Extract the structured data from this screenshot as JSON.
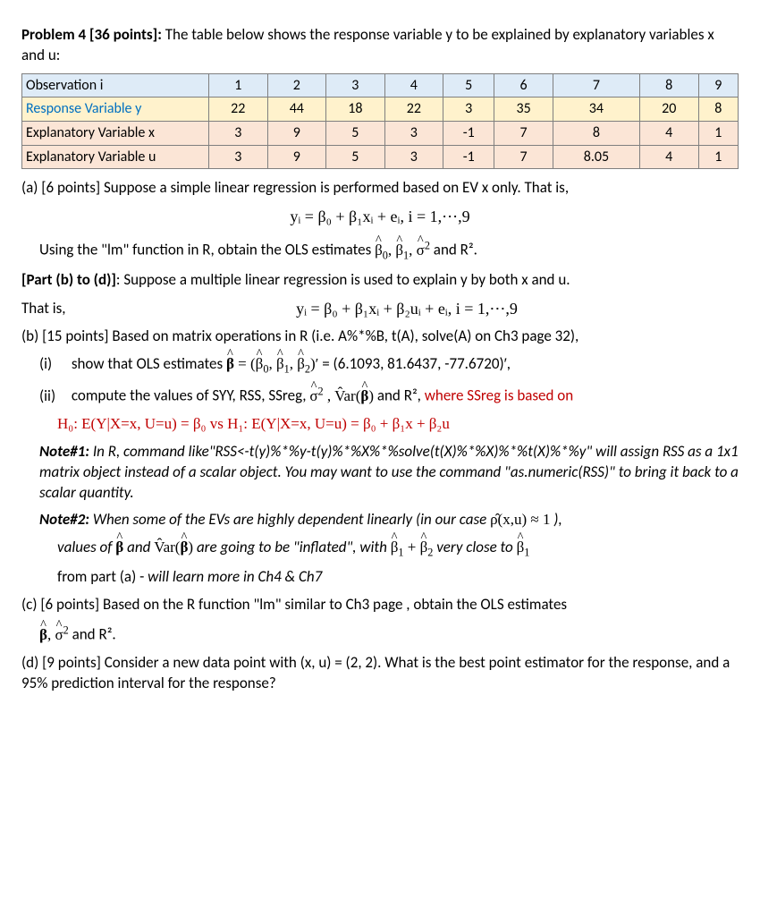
{
  "title_bold": "Problem 4 [36 points]:",
  "title_rest": " The table below shows the response variable y to be explained by explanatory variables x and u:",
  "table": {
    "headers": [
      "Observation i",
      "1",
      "2",
      "3",
      "4",
      "5",
      "6",
      "7",
      "8",
      "9"
    ],
    "row_y": [
      "Response Variable y",
      "22",
      "44",
      "18",
      "22",
      "3",
      "35",
      "34",
      "20",
      "8"
    ],
    "row_x": [
      "Explanatory Variable x",
      "3",
      "9",
      "5",
      "3",
      "-1",
      "7",
      "8",
      "4",
      "1"
    ],
    "row_u": [
      "Explanatory Variable u",
      "3",
      "9",
      "5",
      "3",
      "-1",
      "7",
      "8.05",
      "4",
      "1"
    ]
  },
  "a_lead": "(a) [6 points] Suppose a simple linear regression is performed based on EV x only. That is,",
  "a_eq": "yᵢ = β₀ + β₁xᵢ + eᵢ,    i = 1,⋯,9",
  "a_using": "Using the \"lm\" function in R, obtain the OLS estimates ",
  "a_using_tail": " and R².",
  "bd_lead_bold": "[Part (b) to (d)]",
  "bd_lead_rest": ": Suppose a multiple linear regression is used to explain y by both x and u.",
  "bd_thatis": "That is,",
  "bd_eq": "yᵢ = β₀ + β₁xᵢ + β₂uᵢ + eᵢ,    i = 1,⋯,9",
  "b_lead": "(b) [15 points] Based on matrix operations in R (i.e. A%*%B, t(A), solve(A) on Ch3 page 32),",
  "b_i": "(i)",
  "b_i_text": "show that OLS estimates  ",
  "b_i_vals": " = (6.1093, 81.6437, -77.6720)′,",
  "b_ii": "(ii)",
  "b_ii_text": "compute the values of SYY, RSS, SSreg, ",
  "b_ii_tail_black": " and R², ",
  "b_ii_tail_red": "where SSreg is based on",
  "b_ii_hyp_h0": "H₀: E(Y|X=x, U=u) = β₀    vs    H₁: E(Y|X=x, U=u) = β₀ + β₁x + β₂u",
  "note1_bold": "Note#1:",
  "note1_text": " In R, command like\"RSS<-t(y)%*%y-t(y)%*%X%*%solve(t(X)%*%X)%*%t(X)%*%y\" will assign RSS as a 1x1 matrix object instead of a scalar object. You may want to use the command \"as.numeric(RSS)\" to bring it back to a scalar quantity.",
  "note2_bold": "Note#2:",
  "note2_text": " When some of the EVs are highly dependent linearly (in our case ",
  "note2_tail": " ),",
  "note2_rho": "ρ̂(x,u) ≈ 1",
  "note2_line_a": "values of  ",
  "note2_line_mid": "  and  ",
  "note2_line_var": "V̂ar(β̂)",
  "note2_line_b": " are going to be \"inflated\", with  ",
  "note2_line_close": "  very close to  ",
  "note2_line2": "from part (a) - will learn more in Ch4 & Ch7",
  "c_lead": "(c)  [6 points] Based on the R function \"lm\" similar to Ch3 page , obtain the OLS estimates",
  "c_line2": " and R².",
  "d_lead": "(d)  [9 points] Consider a new data point with (x, u) = (2, 2). What is the best point estimator for the response, and a 95% prediction interval for the response?"
}
